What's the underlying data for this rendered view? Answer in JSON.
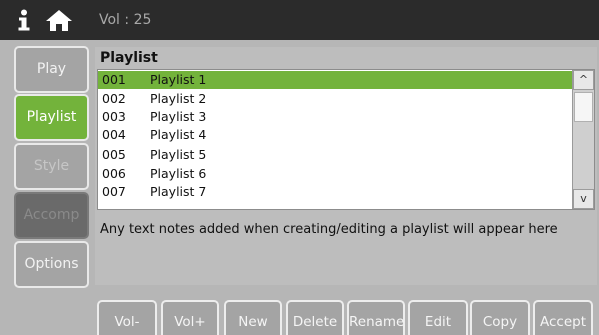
{
  "header": {
    "volume_text": "Vol : 25",
    "icons": [
      "info-icon",
      "home-icon"
    ]
  },
  "sidebar": {
    "tabs": [
      {
        "label": "Play",
        "state": "normal"
      },
      {
        "label": "Playlist",
        "state": "active"
      },
      {
        "label": "Style",
        "state": "dim"
      },
      {
        "label": "Accomp",
        "state": "disabled"
      },
      {
        "label": "Options",
        "state": "normal"
      }
    ]
  },
  "playlist": {
    "title": "Playlist",
    "items": [
      {
        "num": "001",
        "name": "Playlist 1",
        "selected": true
      },
      {
        "num": "002",
        "name": "Playlist 2"
      },
      {
        "num": "003",
        "name": "Playlist 3"
      },
      {
        "num": "004",
        "name": "Playlist 4"
      },
      {
        "num": "005",
        "name": "Playlist 5"
      },
      {
        "num": "006",
        "name": "Playlist 6"
      },
      {
        "num": "007",
        "name": "Playlist 7"
      }
    ],
    "scroll_up": "^",
    "scroll_down": "v",
    "notes": "Any text notes added when creating/editing a playlist will appear here"
  },
  "toolbar": {
    "buttons": [
      "Vol-",
      "Vol+",
      "New",
      "Delete",
      "Rename",
      "Edit",
      "Copy",
      "Accept"
    ]
  },
  "colors": {
    "accent_green": "#73b33b",
    "topbar": "#2b2b2b",
    "button_gray": "#a4a4a4"
  }
}
